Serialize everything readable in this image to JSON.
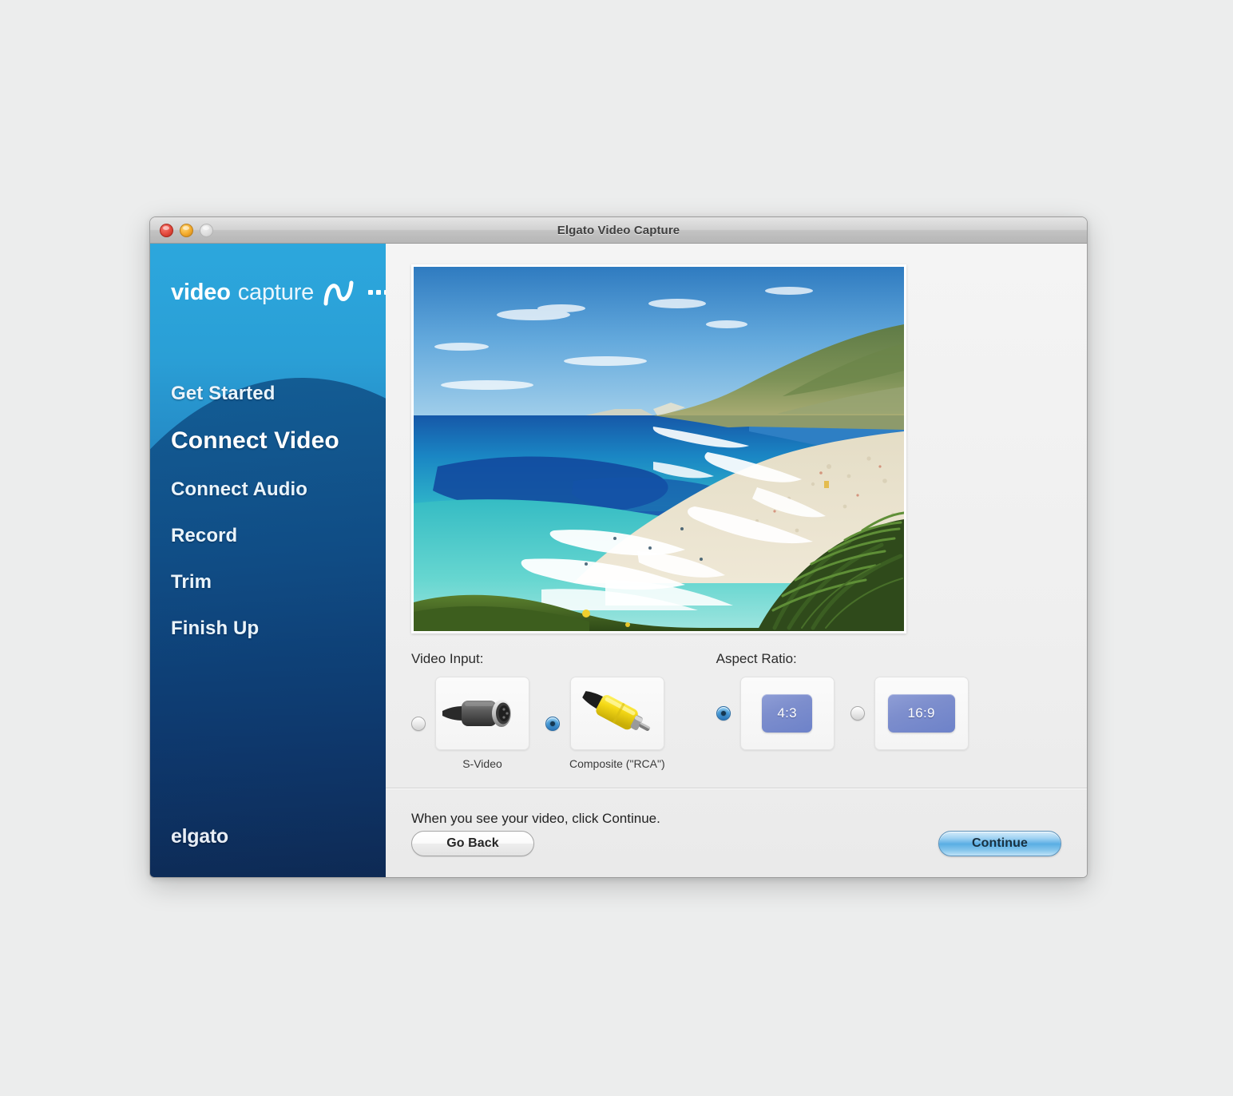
{
  "window": {
    "title": "Elgato Video Capture",
    "traffic_lights": [
      {
        "name": "close",
        "color": "#e2483c"
      },
      {
        "name": "minimize",
        "color": "#f3aa2a"
      },
      {
        "name": "zoom",
        "color": "#dcdcdc"
      }
    ]
  },
  "sidebar": {
    "brand": {
      "word_primary": "video",
      "word_secondary": "capture",
      "wave_icon": "waveform-icon",
      "dots": 3
    },
    "items": [
      {
        "label": "Get Started",
        "active": false
      },
      {
        "label": "Connect Video",
        "active": true
      },
      {
        "label": "Connect Audio",
        "active": false
      },
      {
        "label": "Record",
        "active": false
      },
      {
        "label": "Trim",
        "active": false
      },
      {
        "label": "Finish Up",
        "active": false
      }
    ],
    "footer_logo": "elgato",
    "colors": {
      "top": "#2ca7dd",
      "bottom": "#121f42"
    }
  },
  "main": {
    "preview": {
      "alt": "Live video preview of a coastal beach scene with turquoise sea, headland and palm fronds"
    },
    "video_input": {
      "label": "Video Input:",
      "options": [
        {
          "id": "s-video",
          "caption": "S-Video",
          "icon": "s-video-connector-icon",
          "selected": false
        },
        {
          "id": "composite",
          "caption": "Composite (\"RCA\")",
          "icon": "rca-connector-icon",
          "selected": true
        }
      ]
    },
    "aspect_ratio": {
      "label": "Aspect Ratio:",
      "options": [
        {
          "id": "4-3",
          "label": "4:3",
          "selected": true
        },
        {
          "id": "16-9",
          "label": "16:9",
          "selected": false
        }
      ]
    },
    "instruction": "When you see your video, click Continue."
  },
  "footer": {
    "back_label": "Go Back",
    "continue_label": "Continue"
  }
}
